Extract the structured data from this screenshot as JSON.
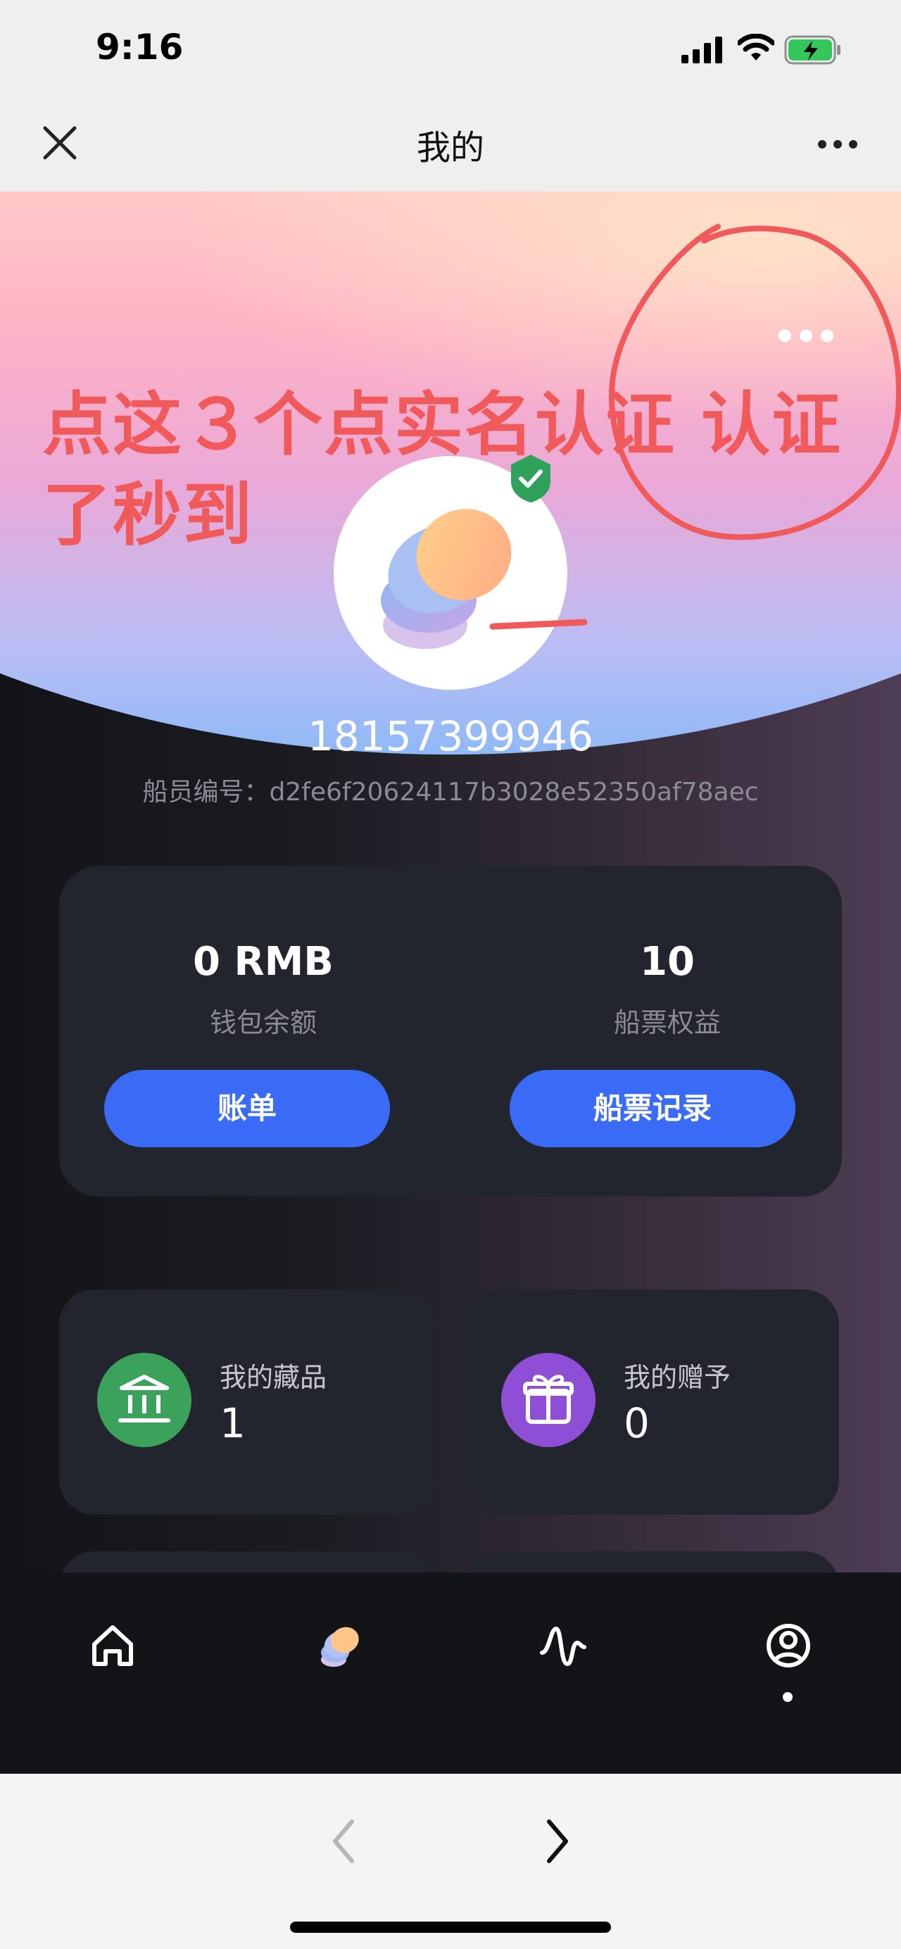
{
  "status_bar": {
    "time": "9:16"
  },
  "nav": {
    "title": "我的",
    "close_icon": "close-icon",
    "more_icon": "more-horizontal-icon"
  },
  "annotation": {
    "text": "点这３个点实名认证 认证了秒到",
    "color": "#f05a5a"
  },
  "profile": {
    "username": "18157399946",
    "member_id": "船员编号：d2fe6f20624117b3028e52350af78aec",
    "verified": true
  },
  "wallet": {
    "balance_value": "0 RMB",
    "balance_label": "钱包余额",
    "ticket_value": "10",
    "ticket_label": "船票权益",
    "bill_button": "账单",
    "ticket_record_button": "船票记录",
    "button_color": "#3a6bf6"
  },
  "cards": [
    {
      "label": "我的藏品",
      "value": "1",
      "icon": "bank-icon",
      "color": "#3ba25c"
    },
    {
      "label": "我的赠予",
      "value": "0",
      "icon": "gift-icon",
      "color": "#8e4fd6"
    }
  ],
  "tabs": [
    {
      "name": "home",
      "icon": "home-icon"
    },
    {
      "name": "collection",
      "icon": "collection-logo-icon"
    },
    {
      "name": "activity",
      "icon": "activity-icon"
    },
    {
      "name": "profile",
      "icon": "user-circle-icon",
      "active": true
    }
  ]
}
